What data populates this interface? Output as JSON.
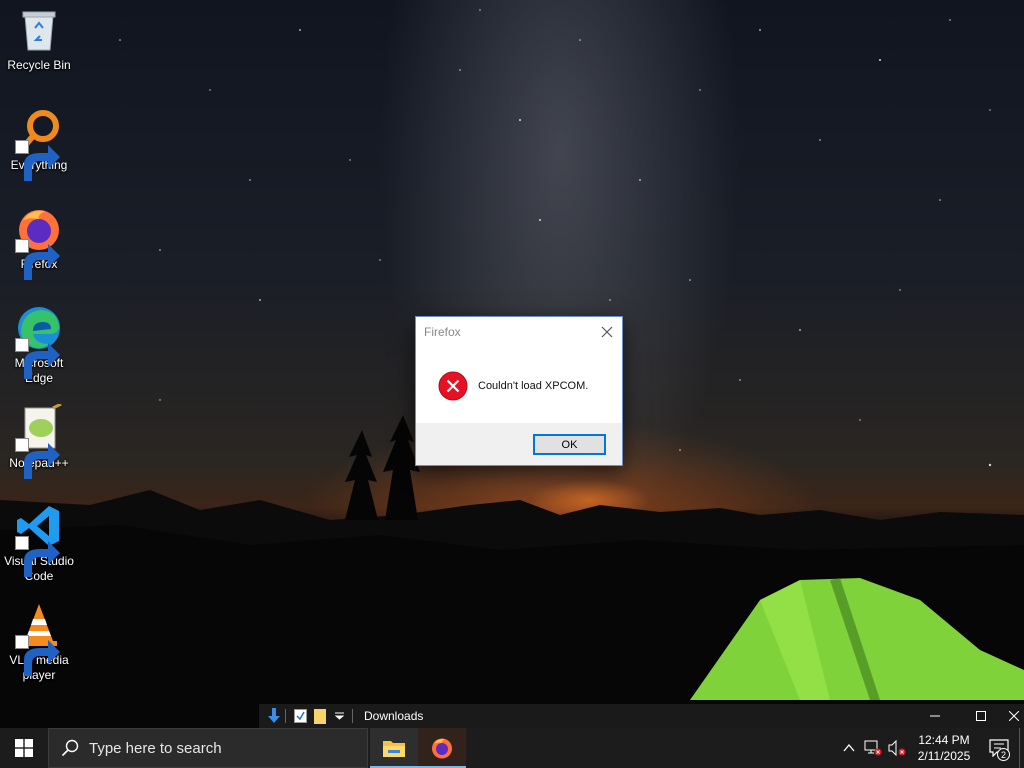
{
  "desktop": {
    "icons": [
      {
        "label": "Recycle Bin",
        "icon": "recycle-bin-icon"
      },
      {
        "label": "Everything",
        "icon": "everything-search-icon"
      },
      {
        "label": "Firefox",
        "icon": "firefox-icon"
      },
      {
        "label": "Microsoft Edge",
        "icon": "edge-icon"
      },
      {
        "label": "Notepad++",
        "icon": "notepad-plus-plus-icon"
      },
      {
        "label": "Visual Studio Code",
        "icon": "vscode-icon"
      },
      {
        "label": "VLC media player",
        "icon": "vlc-icon"
      }
    ]
  },
  "dialog": {
    "title": "Firefox",
    "message": "Couldn't load XPCOM.",
    "ok_label": "OK",
    "icon": "error-icon"
  },
  "downloads_window": {
    "title": "Downloads"
  },
  "taskbar": {
    "search_placeholder": "Type here to search",
    "apps": [
      {
        "name": "File Explorer",
        "icon": "file-explorer-icon"
      },
      {
        "name": "Firefox",
        "icon": "firefox-icon"
      }
    ],
    "clock_time": "12:44 PM",
    "clock_date": "2/11/2025",
    "notification_count": "2"
  },
  "colors": {
    "accent": "#0078d7",
    "error_red": "#e81123",
    "taskbar_bg": "#1c1c1c"
  }
}
